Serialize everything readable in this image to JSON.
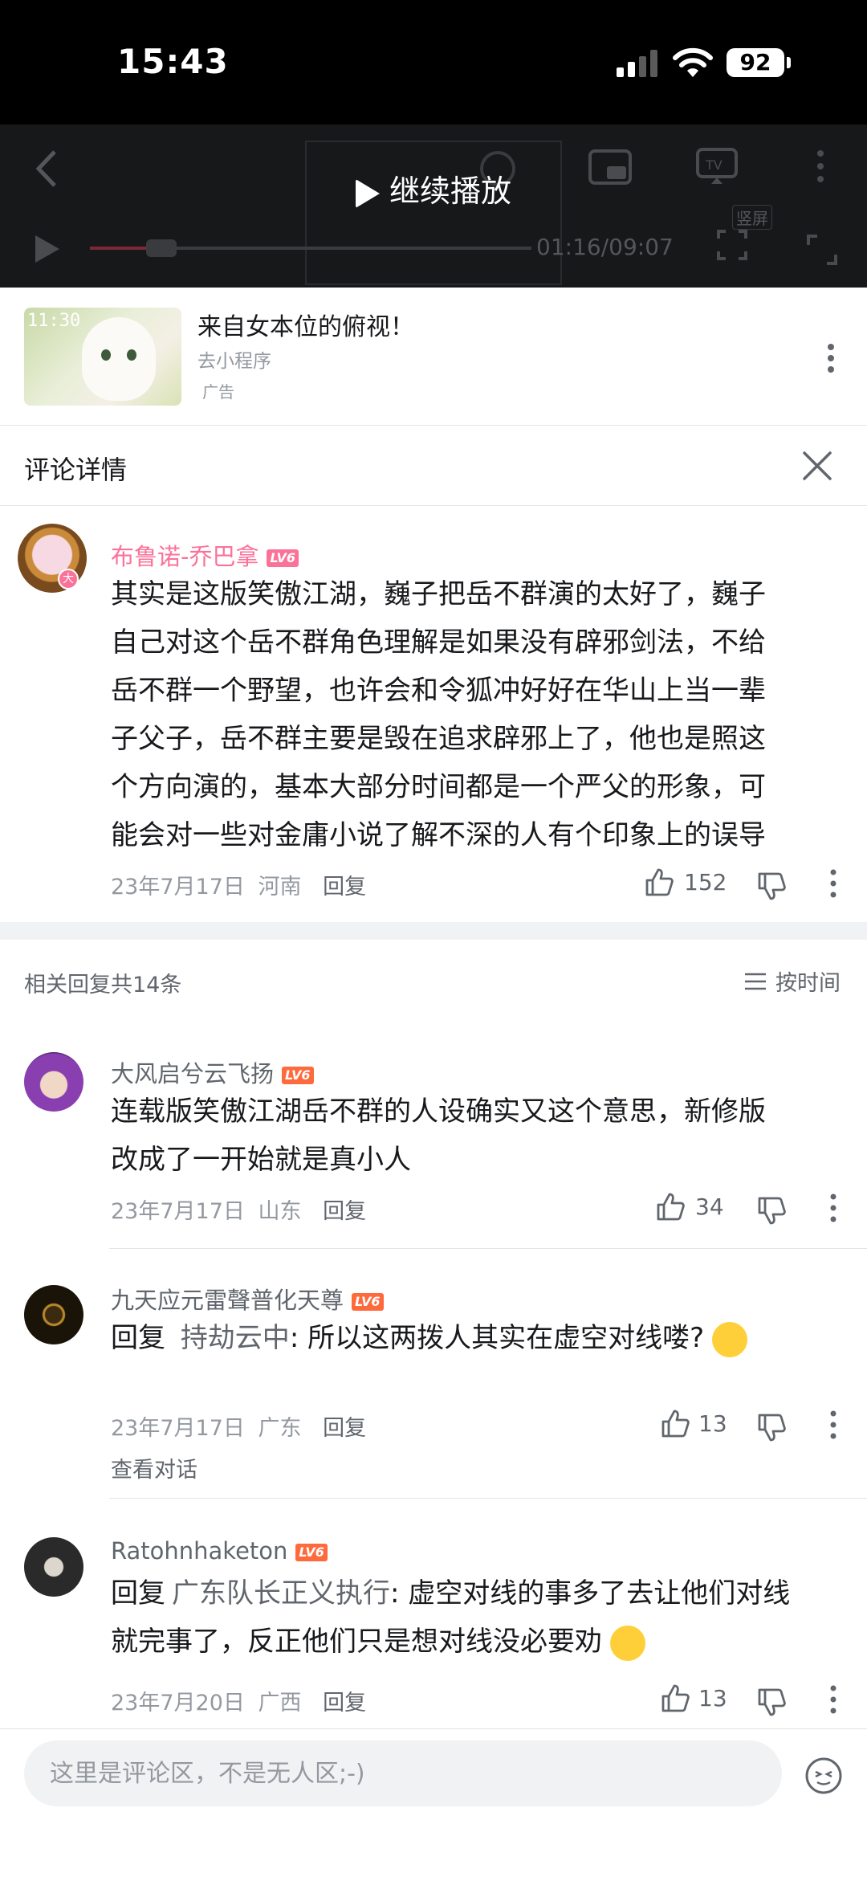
{
  "status": {
    "time": "15:43",
    "battery": "92"
  },
  "player": {
    "continue_label": "继续播放",
    "time": "01:16/09:07",
    "vertical_tag": "竖屏"
  },
  "ad": {
    "title": "来自女本位的俯视！",
    "subtitle": "去小程序",
    "tag": "广告",
    "thumb_clock": "11:30"
  },
  "comment_header": {
    "title": "评论详情"
  },
  "main_comment": {
    "user": "布鲁诺-乔巴拿",
    "level": "LV6",
    "lines": [
      "其实是这版笑傲江湖，巍子把岳不群演的太好了，巍子",
      "自己对这个岳不群角色理解是如果没有辟邪剑法，不给",
      "岳不群一个野望，也许会和令狐冲好好在华山上当一辈",
      "子父子，岳不群主要是毁在追求辟邪上了，他也是照这",
      "个方向演的，基本大部分时间都是一个严父的形象，可",
      "能会对一些对金庸小说了解不深的人有个印象上的误导"
    ],
    "date": "23年7月17日",
    "location": "河南",
    "reply_label": "回复",
    "likes": "152",
    "user_color": "#fb7299"
  },
  "replies_header": {
    "count_label": "相关回复共14条",
    "sort_label": "按时间"
  },
  "replies": [
    {
      "user": "大风启兮云飞扬",
      "level": "LV6",
      "lines": [
        "连载版笑傲江湖岳不群的人设确实又这个意思，新修版",
        "改成了一开始就是真小人"
      ],
      "date": "23年7月17日",
      "location": "山东",
      "reply_label": "回复",
      "likes": "34"
    },
    {
      "user": "九天应元雷聲普化天尊",
      "level": "LV6",
      "reply_prefix": "回复",
      "mention": "持劫云中",
      "text": ": 所以这两拨人其实在虚空对线喽?",
      "date": "23年7月17日",
      "location": "广东",
      "reply_label": "回复",
      "likes": "13",
      "view_convo": "查看对话"
    },
    {
      "user": "Ratohnhaketon",
      "level": "LV6",
      "reply_prefix": "回复",
      "mention": "广东队长正义执行",
      "text": ": 虚空对线的事多了去让他们对线",
      "text2": "就完事了，反正他们只是想对线没必要劝",
      "date": "23年7月20日",
      "location": "广西",
      "reply_label": "回复",
      "likes": "13"
    }
  ],
  "input": {
    "placeholder": "这里是评论区，不是无人区;-)"
  }
}
